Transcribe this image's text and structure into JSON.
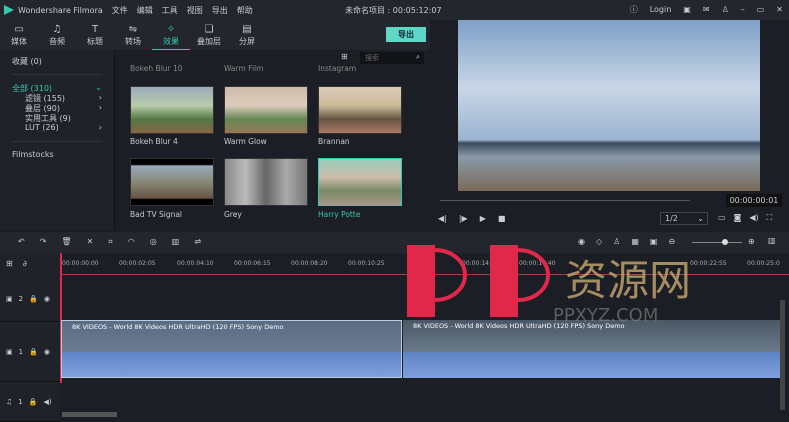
{
  "app": {
    "title": "Wondershare Filmora",
    "menu": [
      "文件",
      "编辑",
      "工具",
      "视图",
      "导出",
      "帮助"
    ],
    "project": "未命名项目 : 00:05:12:07",
    "login": "Login"
  },
  "toolbar": {
    "tabs": [
      {
        "label": "媒体",
        "icon": "folder-icon"
      },
      {
        "label": "音频",
        "icon": "music-icon"
      },
      {
        "label": "标题",
        "icon": "title-icon"
      },
      {
        "label": "转场",
        "icon": "transition-icon"
      },
      {
        "label": "效果",
        "icon": "effects-icon",
        "active": true
      },
      {
        "label": "叠加层",
        "icon": "overlay-icon"
      },
      {
        "label": "分屏",
        "icon": "split-screen-icon"
      }
    ],
    "export": "导出"
  },
  "sidebar": {
    "favorites": "收藏 (0)",
    "all": "全部 (310)",
    "items": [
      {
        "label": "滤镜 (155)"
      },
      {
        "label": "叠层 (90)"
      },
      {
        "label": "实用工具 (9)"
      },
      {
        "label": "LUT (26)"
      }
    ],
    "filmstocks": "Filmstocks"
  },
  "library": {
    "search_placeholder": "搜索",
    "top_row": [
      "Bokeh Blur 10",
      "Warm Film",
      "Instagram"
    ],
    "items": [
      "Bokeh Blur 4",
      "Warm Glow",
      "Brannan",
      "Bad TV Signal",
      "Grey",
      "Harry Potte"
    ]
  },
  "preview": {
    "timecode": "00:00:00:01",
    "zoom": "1/2"
  },
  "timeline": {
    "ticks": [
      "00:00:00:00",
      "00:00:02:05",
      "00:00:04:10",
      "00:00:06:15",
      "00:00:08:20",
      "00:00:10:25",
      "00:00:14:",
      "00:00:16:40",
      "00:00:22:55",
      "00:00:25:0"
    ],
    "tracks": [
      "2",
      "1",
      "1"
    ],
    "clips": [
      "8K VIDEOS - World 8K Videos HDR UltraHD (120 FPS) Sony Demo",
      "8K VIDEOS - World 8K Videos HDR UltraHD (120 FPS) Sony Demo"
    ]
  },
  "watermark": {
    "text": "PP资源网",
    "url": "PPXYZ.COM",
    "color": "#e0284a"
  },
  "colors": {
    "accent": "#37c8b2",
    "playhead": "#e0284a"
  }
}
